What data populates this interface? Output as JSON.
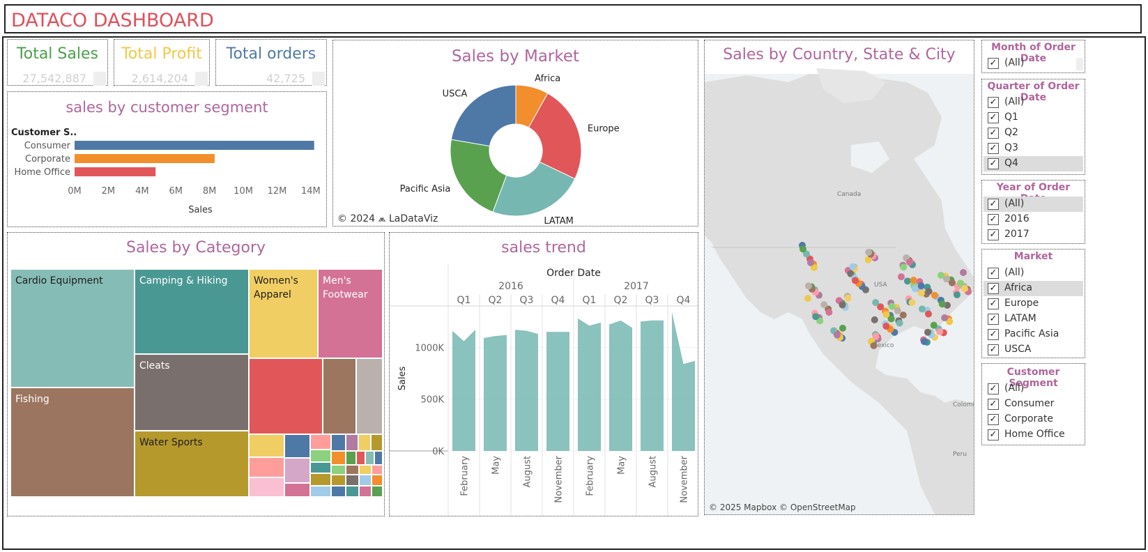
{
  "header": {
    "title": "DATACO DASHBOARD"
  },
  "kpis": [
    {
      "label": "Total Sales",
      "value": "27,542,887",
      "color": "#4aa04a"
    },
    {
      "label": "Total Profit",
      "value": "2,614,204",
      "color": "#f1c84a"
    },
    {
      "label": "Total orders",
      "value": "42,725",
      "color": "#4e79a7"
    }
  ],
  "segment_chart": {
    "title": "sales by customer segment",
    "axis_header": "Customer S..",
    "xlabel": "Sales",
    "ticks": [
      "0M",
      "2M",
      "4M",
      "6M",
      "8M",
      "10M",
      "12M",
      "14M"
    ]
  },
  "market_chart": {
    "title": "Sales by Market",
    "credit": "© 2024 ⩕ LaDataViz"
  },
  "map": {
    "title": "Sales by Country, State & City",
    "labels": {
      "canada": "Canada",
      "usa": "USA",
      "mexico": "Mexico",
      "colombia": "Colombia",
      "peru": "Peru"
    },
    "attribution": "© 2025 Mapbox © OpenStreetMap"
  },
  "category_chart": {
    "title": "Sales by Category"
  },
  "trend_chart": {
    "title": "sales trend",
    "col_header": "Order Date",
    "ylabel": "Sales",
    "years": [
      "2016",
      "2017"
    ],
    "quarters": [
      "Q1",
      "Q2",
      "Q3",
      "Q4",
      "Q1",
      "Q2",
      "Q3",
      "Q4"
    ],
    "months": [
      "February",
      "May",
      "August",
      "November",
      "February",
      "May",
      "August",
      "November"
    ],
    "yticks": [
      "0K",
      "500K",
      "1000K"
    ]
  },
  "filters": {
    "month": {
      "title": "Month of Order Date",
      "items": [
        {
          "label": "(All)",
          "checked": true
        }
      ]
    },
    "quarter": {
      "title": "Quarter of Order Date",
      "items": [
        {
          "label": "(All)",
          "checked": true
        },
        {
          "label": "Q1",
          "checked": true
        },
        {
          "label": "Q2",
          "checked": true
        },
        {
          "label": "Q3",
          "checked": true
        },
        {
          "label": "Q4",
          "checked": true
        }
      ]
    },
    "year": {
      "title": "Year of Order Date",
      "items": [
        {
          "label": "(All)",
          "checked": true
        },
        {
          "label": "2016",
          "checked": true
        },
        {
          "label": "2017",
          "checked": true
        }
      ]
    },
    "market": {
      "title": "Market",
      "items": [
        {
          "label": "(All)",
          "checked": true
        },
        {
          "label": "Africa",
          "checked": true
        },
        {
          "label": "Europe",
          "checked": true
        },
        {
          "label": "LATAM",
          "checked": true
        },
        {
          "label": "Pacific Asia",
          "checked": true
        },
        {
          "label": "USCA",
          "checked": true
        }
      ]
    },
    "segment": {
      "title": "Customer Segment",
      "items": [
        {
          "label": "(All)",
          "checked": true
        },
        {
          "label": "Consumer",
          "checked": true
        },
        {
          "label": "Corporate",
          "checked": true
        },
        {
          "label": "Home Office",
          "checked": true
        }
      ]
    }
  },
  "chart_data": [
    {
      "type": "bar",
      "title": "sales by customer segment",
      "orientation": "horizontal",
      "categories": [
        "Consumer",
        "Corporate",
        "Home Office"
      ],
      "values": [
        14.2,
        8.3,
        4.8
      ],
      "unit": "M",
      "colors": [
        "#4e79a7",
        "#f28e2b",
        "#e15759"
      ],
      "xlabel": "Sales",
      "xlim": [
        0,
        14.5
      ]
    },
    {
      "type": "pie",
      "title": "Sales by Market",
      "donut": true,
      "categories": [
        "Africa",
        "Europe",
        "LATAM",
        "Pacific Asia",
        "USCA"
      ],
      "values": [
        8.1,
        24.0,
        23.6,
        22.0,
        22.3
      ],
      "unit": "%",
      "colors": [
        "#f28e2b",
        "#e15759",
        "#76b7b2",
        "#59a14f",
        "#4e79a7"
      ]
    },
    {
      "type": "area",
      "title": "sales trend",
      "ylabel": "Sales",
      "ylim": [
        0,
        1400
      ],
      "unit": "K",
      "panels": [
        {
          "year": "2016",
          "quarter": "Q1",
          "values": [
            1160,
            1060,
            1170
          ]
        },
        {
          "year": "2016",
          "quarter": "Q2",
          "values": [
            1090,
            1110,
            1120
          ]
        },
        {
          "year": "2016",
          "quarter": "Q3",
          "values": [
            1170,
            1160,
            1130
          ]
        },
        {
          "year": "2016",
          "quarter": "Q4",
          "values": [
            1150,
            1150,
            1150
          ]
        },
        {
          "year": "2017",
          "quarter": "Q1",
          "values": [
            1280,
            1210,
            1240
          ]
        },
        {
          "year": "2017",
          "quarter": "Q2",
          "values": [
            1220,
            1260,
            1190
          ]
        },
        {
          "year": "2017",
          "quarter": "Q3",
          "values": [
            1250,
            1260,
            1260
          ]
        },
        {
          "year": "2017",
          "quarter": "Q4",
          "values": [
            1340,
            840,
            870
          ]
        }
      ],
      "color": "#76b7b2"
    },
    {
      "type": "treemap",
      "title": "Sales by Category",
      "labeled_categories": [
        "Cardio Equipment",
        "Fishing",
        "Camping & Hiking",
        "Cleats",
        "Water Sports",
        "Women's Apparel",
        "Men's Footwear"
      ]
    }
  ]
}
